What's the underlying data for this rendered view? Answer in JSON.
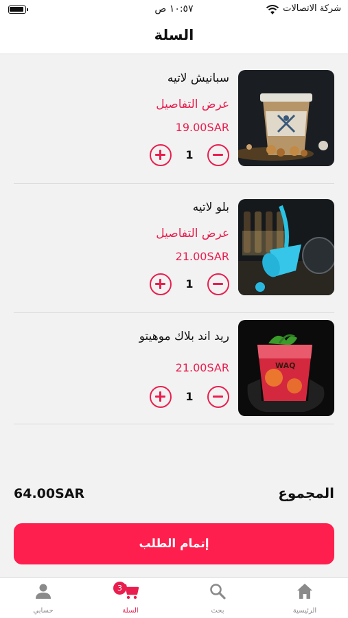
{
  "status_bar": {
    "time": "١٠:٥٧ ص",
    "carrier": "شركة الاتصالات"
  },
  "header": {
    "title": "السلة"
  },
  "cart": {
    "items": [
      {
        "name": "سبانيش لاتيه",
        "details_link": "عرض التفاصيل",
        "price": "19.00SAR",
        "quantity": "1"
      },
      {
        "name": "بلو لاتيه",
        "details_link": "عرض التفاصيل",
        "price": "21.00SAR",
        "quantity": "1"
      },
      {
        "name": "ريد اند بلاك موهيتو",
        "price": "21.00SAR",
        "quantity": "1"
      }
    ]
  },
  "summary": {
    "total_label": "المجموع",
    "total_value": "64.00SAR"
  },
  "checkout": {
    "label": "إتمام الطلب"
  },
  "tabbar": {
    "tabs": [
      {
        "label": "الرئيسية",
        "icon": "home-icon"
      },
      {
        "label": "بحث",
        "icon": "search-icon"
      },
      {
        "label": "السلة",
        "icon": "cart-icon",
        "badge": "3"
      },
      {
        "label": "حسابي",
        "icon": "user-icon"
      }
    ]
  },
  "colors": {
    "accent": "#e91e4e",
    "button": "#ff1f4e",
    "background": "#f2f2f2",
    "inactive_tab": "#8a8a8a"
  }
}
